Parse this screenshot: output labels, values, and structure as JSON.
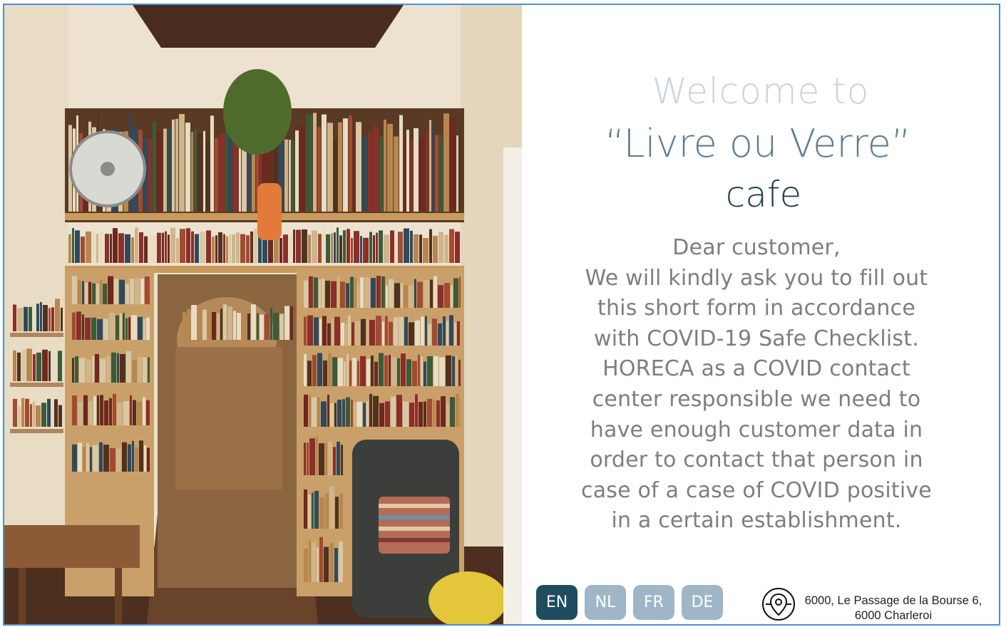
{
  "welcome": {
    "line1": "Welcome to",
    "line2": "“Livre ou Verre”",
    "line3": "cafe"
  },
  "message": {
    "lines": [
      "Dear customer,",
      "We will kindly ask you to fill out",
      "this short form in accordance",
      "with COVID-19 Safe Checklist.",
      "HORECA as a COVID contact",
      "center responsible we need to",
      "have enough customer data in",
      "order to contact that person in",
      "case of a case of COVID positive",
      "in a certain establishment."
    ]
  },
  "languages": [
    {
      "code": "EN",
      "active": true
    },
    {
      "code": "NL",
      "active": false
    },
    {
      "code": "FR",
      "active": false
    },
    {
      "code": "DE",
      "active": false
    }
  ],
  "address": {
    "line1": "6000, Le Passage de la Bourse 6,",
    "line2": "6000 Charleroi"
  },
  "logo": {
    "icon": "location-pin-logo-icon"
  },
  "colors": {
    "frame": "#4a90d9",
    "active_lang": "#1e4c61",
    "inactive_lang": "#9fb6c8",
    "title_light": "#c9d3db",
    "title_mid": "#5f7c8f",
    "title_dark": "#1c3d51",
    "body_text": "#7e7e7e"
  }
}
